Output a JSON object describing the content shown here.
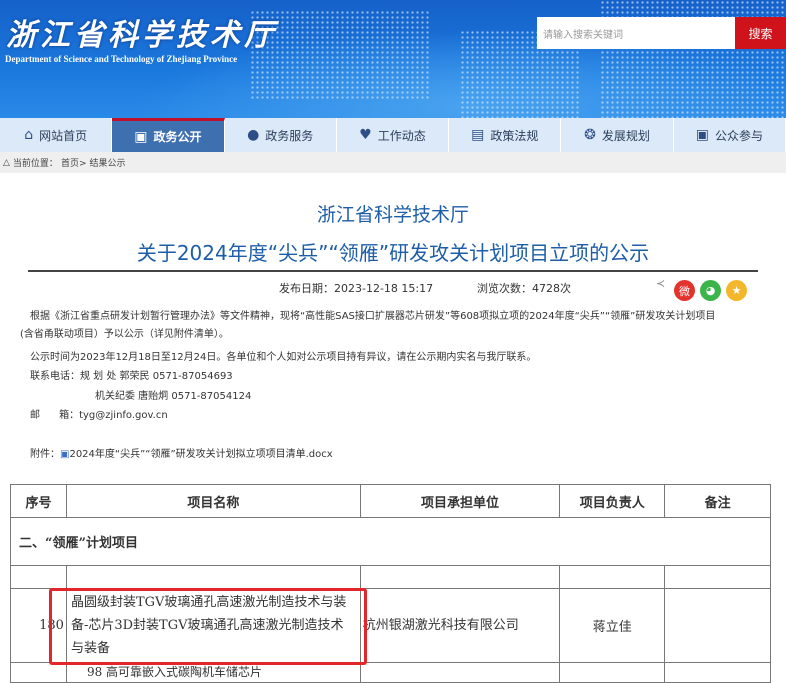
{
  "header": {
    "logo_cn": "浙江省科学技术厅",
    "logo_en": "Department of Science and Technology of Zhejiang Province",
    "search_placeholder": "请输入搜索关键词",
    "search_button": "搜索"
  },
  "nav": [
    {
      "label": "网站首页",
      "icon": "home-icon"
    },
    {
      "label": "政务公开",
      "icon": "org-icon",
      "active": true
    },
    {
      "label": "政务服务",
      "icon": "chat-icon"
    },
    {
      "label": "工作动态",
      "icon": "heart-icon"
    },
    {
      "label": "政策法规",
      "icon": "document-icon"
    },
    {
      "label": "发展规划",
      "icon": "handshake-icon"
    },
    {
      "label": "公众参与",
      "icon": "org-icon"
    }
  ],
  "breadcrumb": {
    "label": "当前位置：",
    "home": "首页>",
    "current": "结果公示"
  },
  "article": {
    "org": "浙江省科学技术厅",
    "title": "关于2024年度“尖兵”“领雁”研发攻关计划项目立项的公示",
    "date": "发布日期：2023-12-18 15:17",
    "views": "浏览次数：4728次",
    "para1a": "根据《浙江省重点研发计划暂行管理办法》等文件精神，现将“高性能SAS接口扩展器芯片研发”等608项拟立项的2024年度“尖兵”“领雁”研发攻关计划项目",
    "para1b": "(含省甬联动项目）予以公示（详见附件清单）。",
    "para2": "公示时间为2023年12月18日至12月24日。各单位和个人如对公示项目持有异议，请在公示期内实名与我厅联系。",
    "contact1": "联系电话：规 划 处  郭荣民  0571-87054693",
    "contact2": "机关纪委  唐贻炯  0571-87054124",
    "email": "邮      箱：tyg@zjinfo.gov.cn",
    "attach_label": "附件：",
    "attach_file": "2024年度“尖兵”“领雁”研发攻关计划拟立项项目清单.docx"
  },
  "table": {
    "headers": [
      "序号",
      "项目名称",
      "项目承担单位",
      "项目负责人",
      "备注"
    ],
    "section": "二、“领雁”计划项目",
    "row": {
      "no": "180",
      "name": "晶圆级封装TGV玻璃通孔高速激光制造技术与装备-芯片3D封装TGV玻璃通孔高速激光制造技术与装备",
      "unit": "杭州银湖激光科技有限公司",
      "leader": "蒋立佳",
      "note": ""
    },
    "next_partial": "98 高可靠嵌入式碳陶机车储芯片"
  },
  "colors": {
    "brand": "#1e5ea8",
    "nav_active": "#3e6fae",
    "search_btn": "#d0121b",
    "highlight": "#e3262b"
  }
}
